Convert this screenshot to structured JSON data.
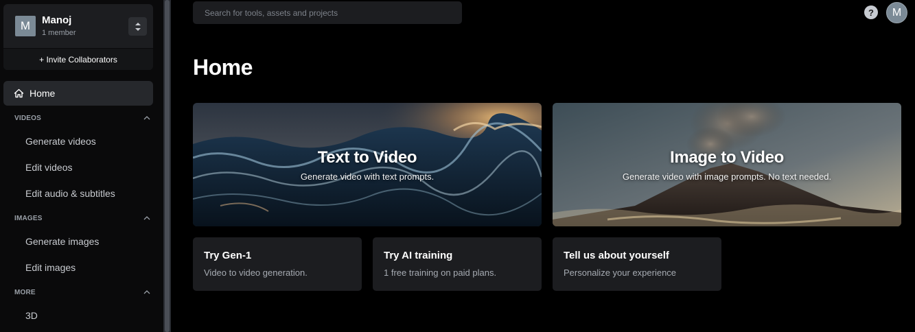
{
  "team": {
    "avatar_letter": "M",
    "name": "Manoj",
    "members": "1 member",
    "invite_label": "+ Invite Collaborators"
  },
  "nav": {
    "home_label": "Home",
    "sections": [
      {
        "heading": "VIDEOS",
        "items": [
          "Generate videos",
          "Edit videos",
          "Edit audio & subtitles"
        ]
      },
      {
        "heading": "IMAGES",
        "items": [
          "Generate images",
          "Edit images"
        ]
      },
      {
        "heading": "MORE",
        "items": [
          "3D"
        ]
      }
    ]
  },
  "search": {
    "placeholder": "Search for tools, assets and projects",
    "value": ""
  },
  "header": {
    "help_label": "?",
    "user_avatar_letter": "M"
  },
  "main": {
    "title": "Home",
    "hero_cards": [
      {
        "title": "Text to Video",
        "subtitle": "Generate video with text prompts."
      },
      {
        "title": "Image to Video",
        "subtitle": "Generate video with image prompts. No text needed."
      }
    ],
    "cards": [
      {
        "title": "Try Gen-1",
        "desc": "Video to video generation."
      },
      {
        "title": "Try AI training",
        "desc": "1 free training on paid plans."
      },
      {
        "title": "Tell us about yourself",
        "desc": "Personalize your experience"
      }
    ]
  },
  "icons": {
    "home": "home-icon",
    "switch": "chevron-up-down-icon",
    "collapse": "chevron-up-icon",
    "help": "help-icon"
  },
  "colors": {
    "background": "#000000",
    "sidebar": "#0a0a0b",
    "card": "#1c1d20",
    "active_nav": "#26282c",
    "avatar": "#7b8a96"
  }
}
